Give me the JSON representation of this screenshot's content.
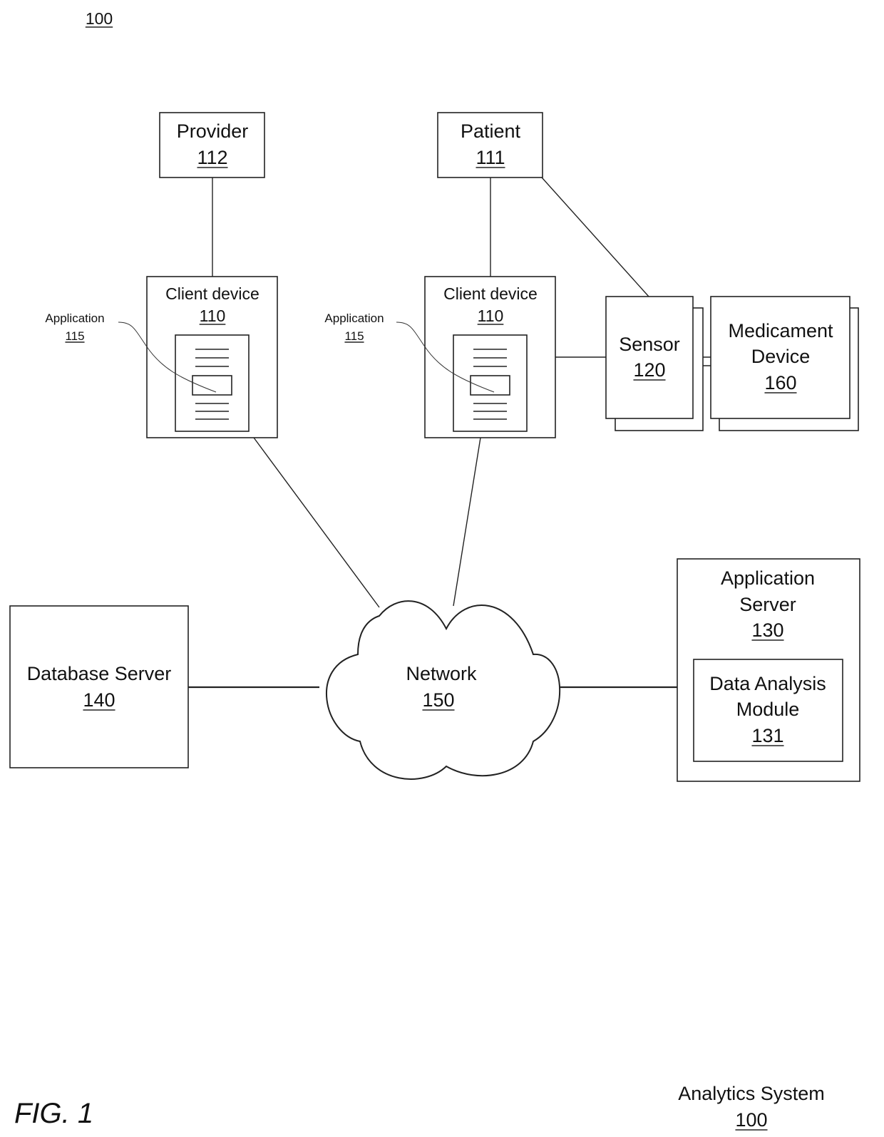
{
  "figure": {
    "top_ref": "100",
    "caption": "FIG. 1",
    "system_title": "Analytics System",
    "system_ref": "100"
  },
  "nodes": {
    "provider": {
      "label": "Provider",
      "ref": "112"
    },
    "patient": {
      "label": "Patient",
      "ref": "111"
    },
    "client_provider": {
      "label": "Client device",
      "ref": "110",
      "app_label": "Application",
      "app_ref": "115"
    },
    "client_patient": {
      "label": "Client device",
      "ref": "110",
      "app_label": "Application",
      "app_ref": "115"
    },
    "sensor": {
      "label": "Sensor",
      "ref": "120"
    },
    "medicament": {
      "label_line1": "Medicament",
      "label_line2": "Device",
      "ref": "160"
    },
    "network": {
      "label": "Network",
      "ref": "150"
    },
    "database_server": {
      "label": "Database Server",
      "ref": "140"
    },
    "application_server": {
      "label_line1": "Application",
      "label_line2": "Server",
      "ref": "130"
    },
    "data_analysis": {
      "label_line1": "Data Analysis",
      "label_line2": "Module",
      "ref": "131"
    }
  },
  "edges": [
    [
      "provider",
      "client_provider"
    ],
    [
      "patient",
      "client_patient"
    ],
    [
      "patient",
      "sensor"
    ],
    [
      "client_patient",
      "sensor"
    ],
    [
      "sensor",
      "medicament"
    ],
    [
      "client_provider",
      "network"
    ],
    [
      "client_patient",
      "network"
    ],
    [
      "database_server",
      "network"
    ],
    [
      "network",
      "application_server"
    ]
  ]
}
